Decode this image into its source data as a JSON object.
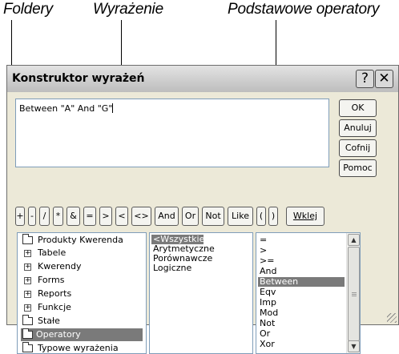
{
  "callouts": {
    "folders": "Foldery",
    "expression": "Wyrażenie",
    "operators": "Podstawowe operatory"
  },
  "window": {
    "title": "Konstruktor wyrażeń",
    "help_icon": "question-mark",
    "close_icon": "close-x"
  },
  "expression": {
    "value": "Between \"A\" And \"G\""
  },
  "buttons": {
    "ok": "OK",
    "cancel": "Anuluj",
    "undo": "Cofnij",
    "help": "Pomoc",
    "paste": "Wklej"
  },
  "operator_buttons": [
    "+",
    "-",
    "/",
    "*",
    "&",
    "=",
    ">",
    "<",
    "<>",
    "And",
    "Or",
    "Not",
    "Like",
    "(",
    ")"
  ],
  "folders_tree": [
    {
      "label": "Produkty Kwerenda",
      "icon": "folder-icon",
      "selected": false
    },
    {
      "label": "Tabele",
      "icon": "expand-plus-icon",
      "selected": false
    },
    {
      "label": "Kwerendy",
      "icon": "expand-plus-icon",
      "selected": false
    },
    {
      "label": "Forms",
      "icon": "expand-plus-icon",
      "selected": false
    },
    {
      "label": "Reports",
      "icon": "expand-plus-icon",
      "selected": false
    },
    {
      "label": "Funkcje",
      "icon": "expand-plus-icon",
      "selected": false
    },
    {
      "label": "Stałe",
      "icon": "folder-icon",
      "selected": false
    },
    {
      "label": "Operatory",
      "icon": "open-folder-icon",
      "selected": true
    },
    {
      "label": "Typowe wyrażenia",
      "icon": "folder-icon",
      "selected": false
    }
  ],
  "categories": [
    {
      "label": "<Wszystkie>",
      "selected": true
    },
    {
      "label": "Arytmetyczne",
      "selected": false
    },
    {
      "label": "Porównawcze",
      "selected": false
    },
    {
      "label": "Logiczne",
      "selected": false
    }
  ],
  "operators_list": [
    {
      "label": "=",
      "selected": false
    },
    {
      "label": ">",
      "selected": false
    },
    {
      "label": ">=",
      "selected": false
    },
    {
      "label": "And",
      "selected": false
    },
    {
      "label": "Between",
      "selected": true
    },
    {
      "label": "Eqv",
      "selected": false
    },
    {
      "label": "Imp",
      "selected": false
    },
    {
      "label": "Mod",
      "selected": false
    },
    {
      "label": "Not",
      "selected": false
    },
    {
      "label": "Or",
      "selected": false
    },
    {
      "label": "Xor",
      "selected": false
    }
  ],
  "colors": {
    "selection": "#7a7a7a",
    "dialog_bg": "#ece9d8"
  }
}
